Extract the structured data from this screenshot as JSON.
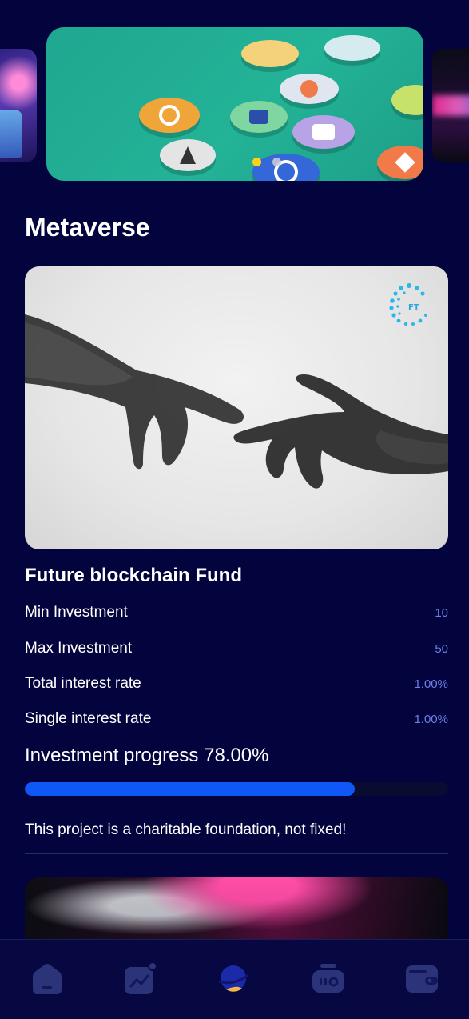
{
  "banner": {
    "slides": [
      "metaverse-avatar-slide",
      "crypto-coins-slide",
      "neon-city-slide"
    ],
    "active_index": 0,
    "dot_count": 2
  },
  "section": {
    "title": "Metaverse"
  },
  "fund": {
    "logo_text": "FT",
    "title": "Future blockchain Fund",
    "rows": [
      {
        "label": "Min Investment",
        "value": "10"
      },
      {
        "label": "Max Investment",
        "value": "50"
      },
      {
        "label": "Total interest rate",
        "value": "1.00%"
      },
      {
        "label": "Single interest rate",
        "value": "1.00%"
      }
    ],
    "progress_label": "Investment progress 78.00%",
    "progress": 0.78,
    "note": "This project is a charitable foundation, not fixed!"
  },
  "nav": {
    "items": [
      {
        "name": "home",
        "icon": "home-icon"
      },
      {
        "name": "market",
        "icon": "chart-icon"
      },
      {
        "name": "explore",
        "icon": "planet-icon"
      },
      {
        "name": "orders",
        "icon": "ticket-icon"
      },
      {
        "name": "wallet",
        "icon": "wallet-icon"
      }
    ]
  },
  "colors": {
    "background": "#03033d",
    "accent": "#0f58f5",
    "value_text": "#6e7fe8",
    "active_dot": "#ffd21a"
  }
}
